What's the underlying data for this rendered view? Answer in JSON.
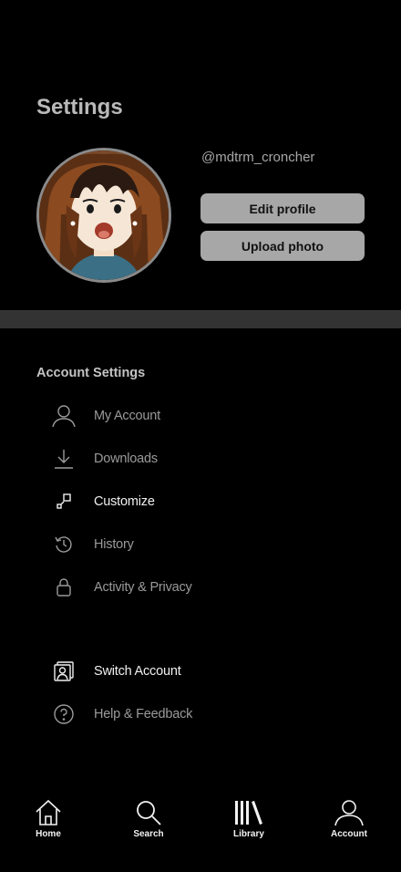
{
  "header": {
    "title": "Settings"
  },
  "profile": {
    "username": "@mdtrm_croncher",
    "edit_label": "Edit profile",
    "upload_label": "Upload photo"
  },
  "account_settings": {
    "title": "Account Settings",
    "items": [
      {
        "label": "My Account",
        "icon": "user-icon"
      },
      {
        "label": "Downloads",
        "icon": "download-icon"
      },
      {
        "label": "Customize",
        "icon": "customize-icon",
        "active": true
      },
      {
        "label": "History",
        "icon": "history-icon"
      },
      {
        "label": "Activity & Privacy",
        "icon": "lock-icon"
      }
    ],
    "extra_items": [
      {
        "label": "Switch Account",
        "icon": "switch-account-icon",
        "active": true
      },
      {
        "label": "Help & Feedback",
        "icon": "help-icon"
      }
    ]
  },
  "bottom_nav": [
    {
      "label": "Home",
      "icon": "home-icon"
    },
    {
      "label": "Search",
      "icon": "search-icon"
    },
    {
      "label": "Library",
      "icon": "library-icon"
    },
    {
      "label": "Account",
      "icon": "account-icon",
      "active": true
    }
  ],
  "colors": {
    "background": "#000000",
    "button": "#a7a7a7",
    "divider": "#333333",
    "muted_text": "#9a9a9a"
  }
}
